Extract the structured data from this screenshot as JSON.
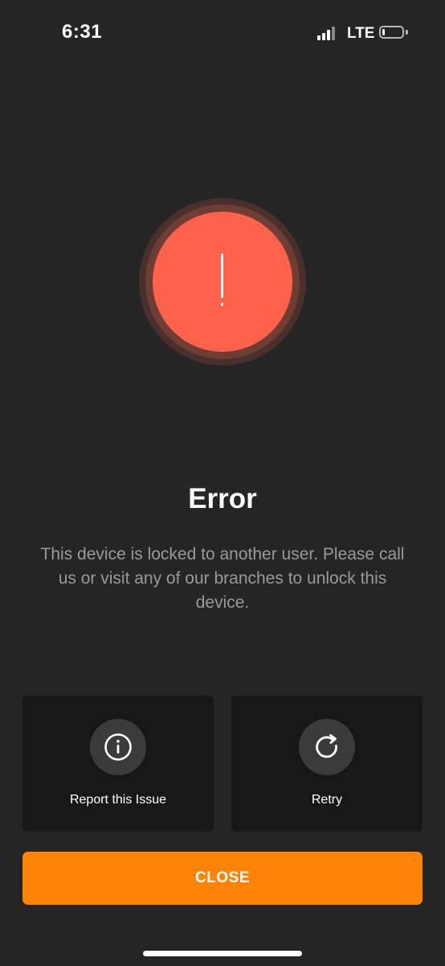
{
  "status_bar": {
    "time": "6:31",
    "network": "LTE",
    "signal_icon": "signal-bars-icon",
    "battery_icon": "battery-low-icon",
    "battery_level": 0.15
  },
  "error": {
    "icon": "exclamation-icon",
    "title": "Error",
    "message": "This device is locked to another user. Please call us or visit any of our branches to unlock this device."
  },
  "actions": {
    "report": {
      "icon": "info-icon",
      "label": "Report this Issue"
    },
    "retry": {
      "icon": "refresh-icon",
      "label": "Retry"
    },
    "close_label": "CLOSE"
  },
  "colors": {
    "background": "#252525",
    "error_red": "#ff624a",
    "accent_orange": "#ff8306",
    "card_bg": "#171717",
    "message_gray": "#9a9a9a"
  }
}
